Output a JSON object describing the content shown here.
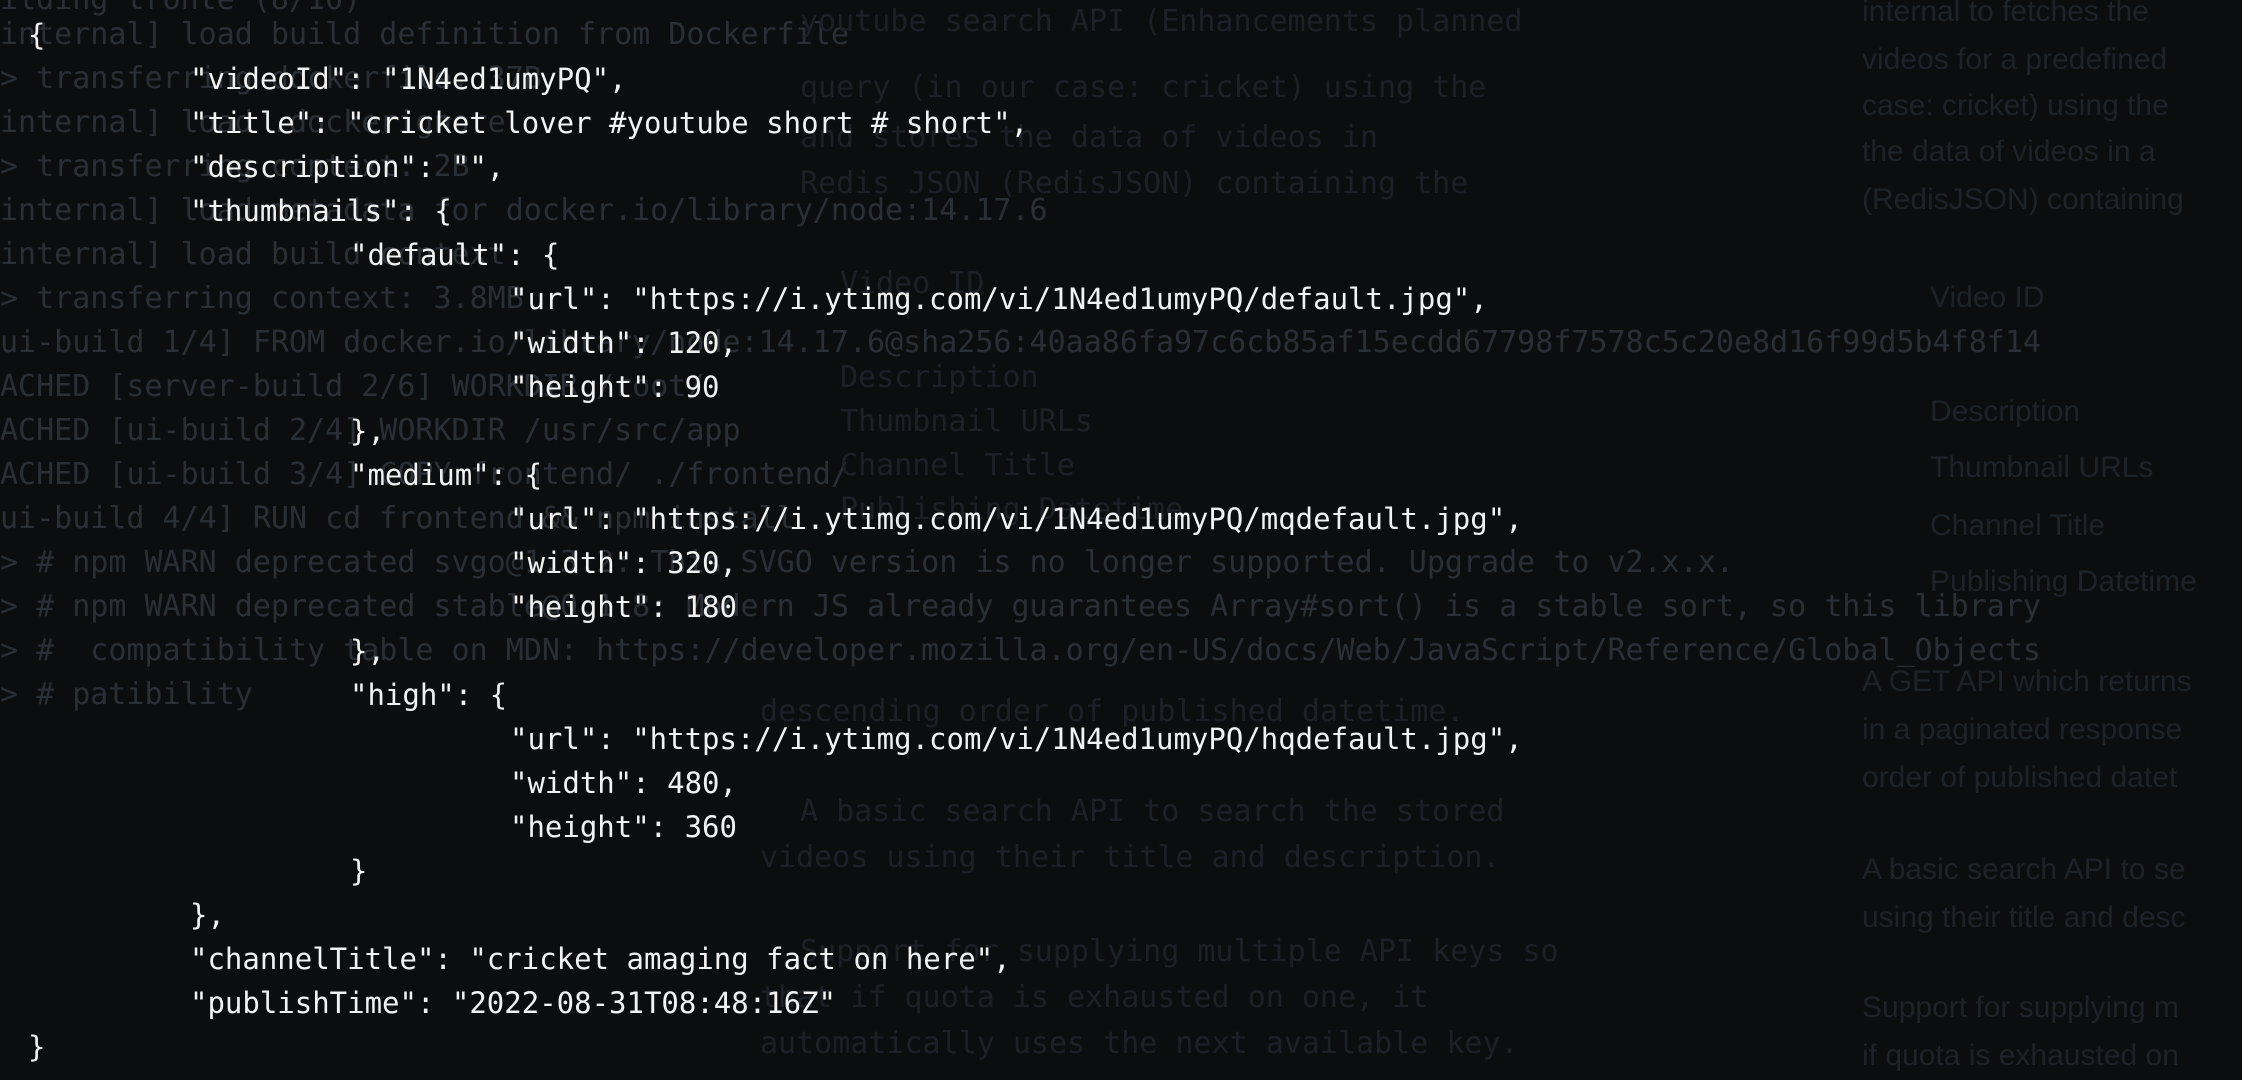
{
  "background_terminal": {
    "lines": [
      "ilding tronte (8/10)",
      "internal] load build definition from Dockerfile",
      "> transferring dockerfile: 37B",
      "internal] load .dockerignore",
      "> transferring context: 2B",
      "internal] load metadata for docker.io/library/node:14.17.6",
      "internal] load build context",
      "> transferring context: 3.8MB",
      "ui-build 1/4] FROM docker.io/library/node:14.17.6@sha256:40aa86fa97c6cb85af15ecdd67798f7578c5c20e8d16f99d5b4f8f14",
      "ACHED [server-build 2/6] WORKDIR /root/",
      "ACHED [ui-build 2/4] WORKDIR /usr/src/app",
      "ACHED [ui-build 3/4] COPY frontend/ ./frontend/",
      "ui-build 4/4] RUN cd frontend && npm install",
      "> # npm WARN deprecated svgo@1.3.2: This SVGO version is no longer supported. Upgrade to v2.x.x.",
      "> # npm WARN deprecated stable@0.1.8: Modern JS already guarantees Array#sort() is a stable sort, so this library",
      "> #  compatibility table on MDN: https://developer.mozilla.org/en-US/docs/Web/JavaScript/Reference/Global_Objects",
      "> # patibility"
    ],
    "middle_lines": [
      "youtube search API (Enhancements planned",
      "query (in our case: cricket) using the",
      "and stores the data of videos in",
      "Redis JSON (RedisJSON) containing the",
      "Video ID",
      "Description",
      "Thumbnail URLs",
      "Channel Title",
      "Publishing Datetime",
      "descending order of published datetime.",
      "A basic search API to search the stored",
      "videos using their title and description.",
      "Support for supplying multiple API keys so",
      "that if quota is exhausted on one, it",
      "automatically uses the next available key."
    ],
    "right_lines": [
      "internal to fetches the",
      "videos for a predefined",
      "case: cricket) using the",
      "the data of videos in a",
      "(RedisJSON) containing",
      "Video ID",
      "Description",
      "Thumbnail URLs",
      "Channel Title",
      "Publishing Datetime",
      "A GET API which returns",
      "in a paginated response",
      "order of published datet",
      "A basic search API to se",
      "using their title and desc",
      "Support for supplying m",
      "if quota is exhausted on"
    ]
  },
  "json": {
    "open": "{",
    "videoId_line": "\"videoId\": \"1N4ed1umyPQ\",",
    "title_line": "\"title\": \"cricket lover #youtube short # short\",",
    "description_line": "\"description\": \"\",",
    "thumbnails_line": "\"thumbnails\": {",
    "default_line": "\"default\": {",
    "default_url": "\"url\": \"https://i.ytimg.com/vi/1N4ed1umyPQ/default.jpg\",",
    "default_width": "\"width\": 120,",
    "default_height": "\"height\": 90",
    "default_close": "},",
    "medium_line": "\"medium\": {",
    "medium_url": "\"url\": \"https://i.ytimg.com/vi/1N4ed1umyPQ/mqdefault.jpg\",",
    "medium_width": "\"width\": 320,",
    "medium_height": "\"height\": 180",
    "medium_close": "},",
    "high_line": "\"high\": {",
    "high_url": "\"url\": \"https://i.ytimg.com/vi/1N4ed1umyPQ/hqdefault.jpg\",",
    "high_width": "\"width\": 480,",
    "high_height": "\"height\": 360",
    "high_close": "}",
    "thumbnails_close": "},",
    "channelTitle_line": "\"channelTitle\": \"cricket amaging fact on here\",",
    "publishTime_line": "\"publishTime\": \"2022-08-31T08:48:16Z\"",
    "close": "}"
  }
}
